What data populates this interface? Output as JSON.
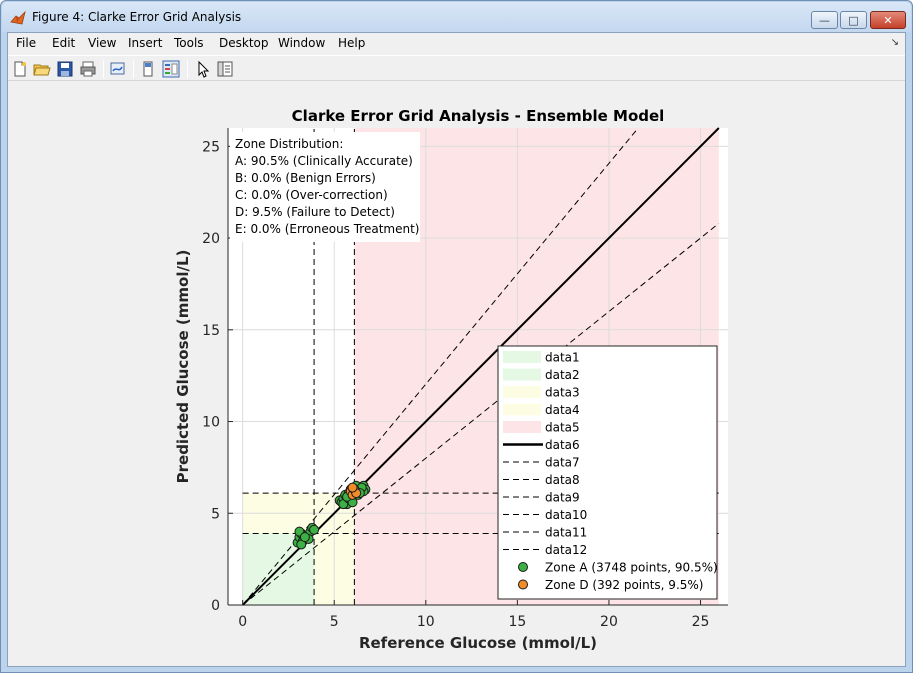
{
  "window": {
    "title": "Figure 4: Clarke Error Grid Analysis",
    "minimize_glyph": "—",
    "maximize_glyph": "□",
    "close_glyph": "✕"
  },
  "menubar": {
    "items": [
      "File",
      "Edit",
      "View",
      "Insert",
      "Tools",
      "Desktop",
      "Window",
      "Help"
    ],
    "overflow_glyph": "↘"
  },
  "toolbar": {
    "icons": [
      "new-figure-icon",
      "open-file-icon",
      "save-icon",
      "print-icon",
      "link-plot-icon",
      "hide-plot-tools-icon",
      "show-plot-tools-icon",
      "edit-plot-icon",
      "property-inspector-icon"
    ]
  },
  "chart_data": {
    "type": "scatter",
    "title": "Clarke Error Grid Analysis - Ensemble Model",
    "xlabel": "Reference Glucose (mmol/L)",
    "ylabel": "Predicted Glucose (mmol/L)",
    "xlim": [
      -0.8,
      26.5
    ],
    "ylim": [
      0,
      26
    ],
    "xticks": [
      0,
      5,
      10,
      15,
      20,
      25
    ],
    "yticks": [
      0,
      5,
      10,
      15,
      20,
      25
    ],
    "grid": true,
    "legend_position": "bottom-right",
    "annotation": {
      "lines": [
        "Zone Distribution:",
        "A: 90.5% (Clinically Accurate)",
        "B: 0.0% (Benign Errors)",
        "C: 0.0% (Over-correction)",
        "D: 9.5% (Failure to Detect)",
        "E: 0.0% (Erroneous Treatment)"
      ]
    },
    "regions": [
      {
        "name": "data1",
        "color": "#e4f8e4",
        "polygon": [
          [
            0,
            0
          ],
          [
            3.9,
            0
          ],
          [
            3.9,
            4.7
          ],
          [
            0,
            4.7
          ]
        ]
      },
      {
        "name": "data2",
        "color": "#e4f8e4",
        "polygon": [
          [
            0,
            0
          ],
          [
            3.9,
            0
          ],
          [
            3.9,
            3.12
          ]
        ]
      },
      {
        "name": "data3",
        "color": "#fdfde4",
        "polygon": [
          [
            0,
            3.9
          ],
          [
            3.9,
            3.9
          ],
          [
            3.9,
            6.1
          ],
          [
            0,
            6.1
          ]
        ]
      },
      {
        "name": "data4",
        "color": "#fdfde4",
        "polygon": [
          [
            3.9,
            0
          ],
          [
            6.1,
            0
          ],
          [
            6.1,
            6.1
          ],
          [
            3.9,
            6.1
          ]
        ]
      },
      {
        "name": "data5",
        "color": "#fde4e6",
        "polygon": [
          [
            6.1,
            0
          ],
          [
            26,
            0
          ],
          [
            26,
            26
          ],
          [
            6.1,
            26
          ]
        ]
      }
    ],
    "lines": [
      {
        "name": "data6",
        "style": "solid",
        "width": 2,
        "points": [
          [
            0,
            0
          ],
          [
            26,
            26
          ]
        ]
      },
      {
        "name": "data7",
        "style": "dashed",
        "points": [
          [
            0,
            0
          ],
          [
            26,
            20.8
          ]
        ]
      },
      {
        "name": "data8",
        "style": "dashed",
        "points": [
          [
            0,
            0
          ],
          [
            21.6,
            26
          ]
        ]
      },
      {
        "name": "data9",
        "style": "dashed",
        "points": [
          [
            3.9,
            0
          ],
          [
            3.9,
            26
          ]
        ]
      },
      {
        "name": "data10",
        "style": "dashed",
        "points": [
          [
            6.1,
            0
          ],
          [
            6.1,
            26
          ]
        ]
      },
      {
        "name": "data11",
        "style": "dashed",
        "points": [
          [
            0,
            3.9
          ],
          [
            26,
            3.9
          ]
        ]
      },
      {
        "name": "data12",
        "style": "dashed",
        "points": [
          [
            0,
            6.1
          ],
          [
            26,
            6.1
          ]
        ]
      }
    ],
    "series": [
      {
        "name": "Zone A (3748 points, 90.5%)",
        "color": "#3cb043",
        "x": [
          3.0,
          3.1,
          3.2,
          3.3,
          3.1,
          3.5,
          3.7,
          3.8,
          3.9,
          3.6,
          3.2,
          3.4,
          5.3,
          5.4,
          5.5,
          5.6,
          5.7,
          5.8,
          5.9,
          6.0,
          6.1,
          6.2,
          6.3,
          6.4,
          6.5,
          6.6,
          6.7,
          5.5,
          5.8,
          6.0,
          6.3,
          6.6,
          5.9,
          6.2,
          6.5,
          5.7,
          6.1,
          6.4
        ],
        "y": [
          3.4,
          3.7,
          3.9,
          3.5,
          4.0,
          3.8,
          4.0,
          4.2,
          4.1,
          3.6,
          3.3,
          3.7,
          5.7,
          5.6,
          5.8,
          6.0,
          5.5,
          6.1,
          5.9,
          6.2,
          6.0,
          6.3,
          6.1,
          6.4,
          6.2,
          6.5,
          6.3,
          5.5,
          5.8,
          5.6,
          6.0,
          6.2,
          6.3,
          6.5,
          6.4,
          5.9,
          6.3,
          6.1
        ]
      },
      {
        "name": "Zone D (392 points, 9.5%)",
        "color": "#f28c28",
        "x": [
          5.9,
          6.0,
          6.1,
          6.2,
          6.0
        ],
        "y": [
          6.2,
          6.0,
          6.3,
          6.1,
          6.4
        ]
      }
    ],
    "legend": [
      {
        "label": "data1",
        "kind": "patch",
        "color": "#e4f8e4"
      },
      {
        "label": "data2",
        "kind": "patch",
        "color": "#e4f8e4"
      },
      {
        "label": "data3",
        "kind": "patch",
        "color": "#fdfde4"
      },
      {
        "label": "data4",
        "kind": "patch",
        "color": "#fdfde4"
      },
      {
        "label": "data5",
        "kind": "patch",
        "color": "#fde4e6"
      },
      {
        "label": "data6",
        "kind": "solid"
      },
      {
        "label": "data7",
        "kind": "dashed"
      },
      {
        "label": "data8",
        "kind": "dashed"
      },
      {
        "label": "data9",
        "kind": "dashed"
      },
      {
        "label": "data10",
        "kind": "dashed"
      },
      {
        "label": "data11",
        "kind": "dashed"
      },
      {
        "label": "data12",
        "kind": "dashed"
      },
      {
        "label": "Zone A (3748 points, 90.5%)",
        "kind": "marker",
        "color": "#3cb043"
      },
      {
        "label": "Zone D (392 points, 9.5%)",
        "kind": "marker",
        "color": "#f28c28"
      }
    ]
  }
}
